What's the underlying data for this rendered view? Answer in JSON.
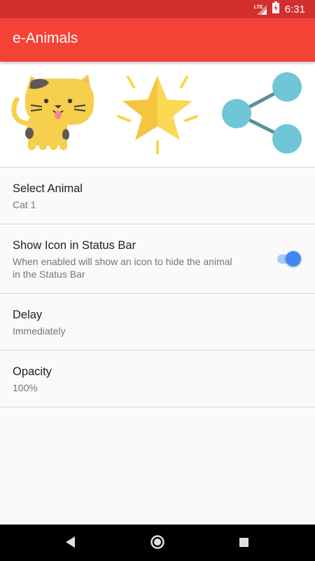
{
  "status_bar": {
    "network": "LTE",
    "time": "6:31",
    "background": "#d32f2f"
  },
  "app_bar": {
    "title": "e-Animals",
    "background": "#f44336"
  },
  "hero_icons": [
    "cat-icon",
    "star-icon",
    "share-icon"
  ],
  "preferences": [
    {
      "title": "Select Animal",
      "summary": "Cat 1"
    },
    {
      "title": "Show Icon in Status Bar",
      "summary_lines": [
        "When enabled will show an icon to hide the animal",
        "in the Status Bar"
      ],
      "toggle_on": true
    },
    {
      "title": "Delay",
      "summary": "Immediately"
    },
    {
      "title": "Opacity",
      "summary": "100%"
    }
  ],
  "colors": {
    "accent": "#4285f4",
    "share": "#6ec6d6"
  },
  "nav_bar": [
    "back-button",
    "home-button",
    "recents-button"
  ]
}
